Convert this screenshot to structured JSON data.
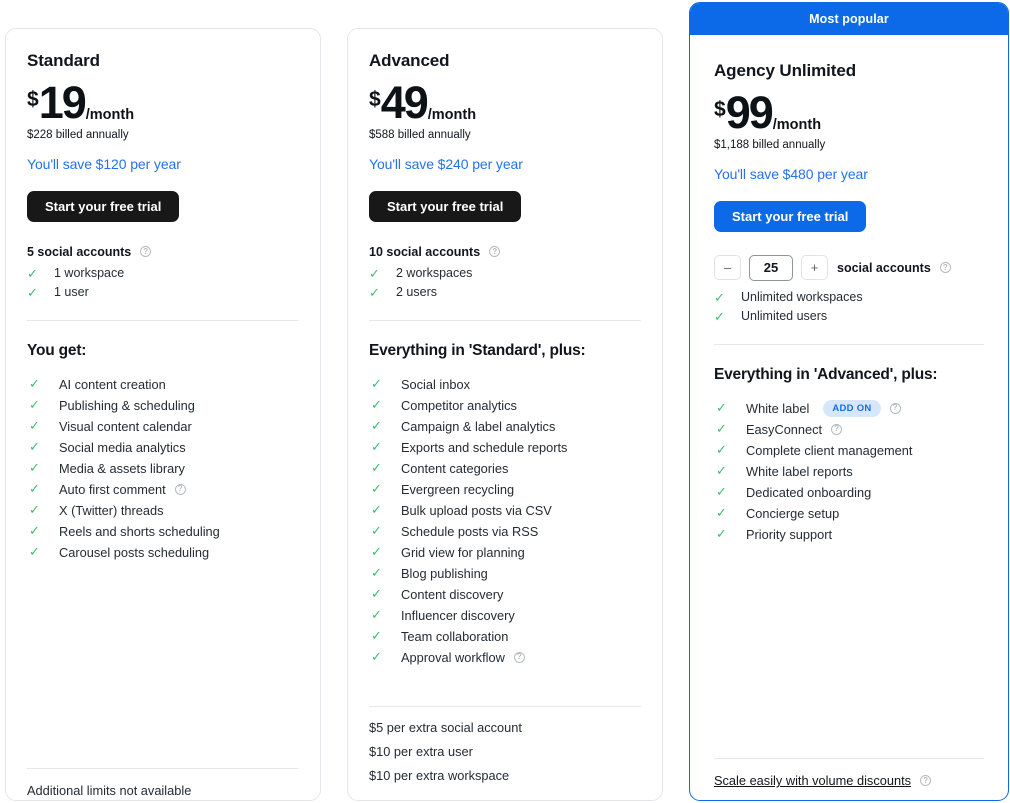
{
  "plans": [
    {
      "id": "standard",
      "name": "Standard",
      "currency": "$",
      "amount": "19",
      "per": "/month",
      "billed": "$228 billed annually",
      "save": "You'll save $120 per year",
      "cta": "Start your free trial",
      "limits_head": "5 social accounts",
      "limits": [
        "1 workspace",
        "1 user"
      ],
      "features_title": "You get:",
      "features": [
        {
          "label": "AI content creation",
          "info": false
        },
        {
          "label": "Publishing & scheduling",
          "info": false
        },
        {
          "label": "Visual content calendar",
          "info": false
        },
        {
          "label": "Social media analytics",
          "info": false
        },
        {
          "label": "Media & assets library",
          "info": false
        },
        {
          "label": "Auto first comment",
          "info": true
        },
        {
          "label": "X (Twitter) threads",
          "info": false
        },
        {
          "label": "Reels and shorts scheduling",
          "info": false
        },
        {
          "label": "Carousel posts scheduling",
          "info": false
        }
      ],
      "footer_note": "Additional limits not available"
    },
    {
      "id": "advanced",
      "name": "Advanced",
      "currency": "$",
      "amount": "49",
      "per": "/month",
      "billed": "$588 billed annually",
      "save": "You'll save $240 per year",
      "cta": "Start your free trial",
      "limits_head": "10 social accounts",
      "limits": [
        "2 workspaces",
        "2 users"
      ],
      "features_title": "Everything in 'Standard', plus:",
      "features": [
        {
          "label": "Social inbox",
          "info": false
        },
        {
          "label": "Competitor analytics",
          "info": false
        },
        {
          "label": "Campaign & label analytics",
          "info": false
        },
        {
          "label": "Exports and schedule reports",
          "info": false
        },
        {
          "label": "Content categories",
          "info": false
        },
        {
          "label": "Evergreen recycling",
          "info": false
        },
        {
          "label": "Bulk upload posts via CSV",
          "info": false
        },
        {
          "label": "Schedule posts via RSS",
          "info": false
        },
        {
          "label": "Grid view for planning",
          "info": false
        },
        {
          "label": "Blog publishing",
          "info": false
        },
        {
          "label": "Content discovery",
          "info": false
        },
        {
          "label": "Influencer discovery",
          "info": false
        },
        {
          "label": "Team collaboration",
          "info": false
        },
        {
          "label": "Approval workflow",
          "info": true
        }
      ],
      "extras": [
        "$5 per extra social account",
        "$10 per extra user",
        "$10 per extra workspace"
      ]
    },
    {
      "id": "agency-unlimited",
      "banner": "Most popular",
      "name": "Agency Unlimited",
      "currency": "$",
      "amount": "99",
      "per": "/month",
      "billed": "$1,188 billed annually",
      "save": "You'll save $480 per year",
      "cta": "Start your free trial",
      "stepper": {
        "decrement": "–",
        "value": "25",
        "increment": "+",
        "label": "social accounts"
      },
      "limits": [
        "Unlimited workspaces",
        "Unlimited users"
      ],
      "features_title": "Everything in 'Advanced', plus:",
      "features": [
        {
          "label": "White label",
          "badge": "ADD ON",
          "info": true
        },
        {
          "label": "EasyConnect",
          "info": true
        },
        {
          "label": "Complete client management",
          "info": false
        },
        {
          "label": "White label reports",
          "info": false
        },
        {
          "label": "Dedicated onboarding",
          "info": false
        },
        {
          "label": "Concierge setup",
          "info": false
        },
        {
          "label": "Priority support",
          "info": false
        }
      ],
      "footer_link": "Scale easily with volume discounts"
    }
  ],
  "icons": {
    "check": "✓",
    "info": "?"
  },
  "colors": {
    "accent_blue": "#0c6ae8",
    "link_blue": "#2272ee",
    "check_green": "#3ebd6e",
    "badge_bg": "#d6e7fb",
    "dark_button": "#181818"
  }
}
